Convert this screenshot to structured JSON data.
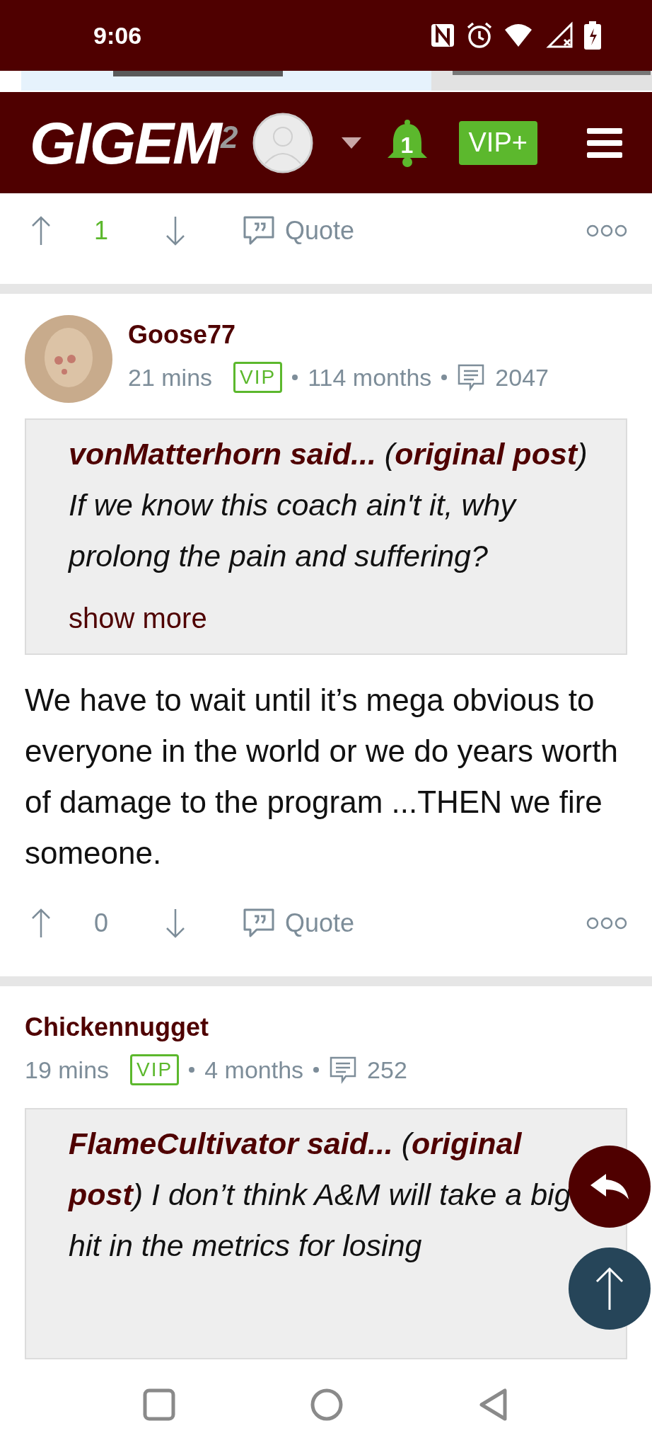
{
  "status_bar": {
    "time": "9:06"
  },
  "header": {
    "logo": "GIGEM",
    "logo_superscript": "2",
    "notification_count": "1",
    "vip_button": "VIP+"
  },
  "top_actions": {
    "score": "1",
    "positive": true,
    "quote": "Quote"
  },
  "posts": [
    {
      "author": "Goose77",
      "has_avatar": true,
      "time": "21 mins",
      "badge": "VIP",
      "tenure": "114 months",
      "post_count": "2047",
      "quote": {
        "text": "**vonMatterhorn said...** (**original post**) If we know this coach ain't it, why prolong the pain and suffering?",
        "show_more": "show more"
      },
      "body": "We have to wait until it’s mega obvious to everyone in the world or we do years worth of damage to the program ...THEN we fire someone.",
      "actions": {
        "score": "0",
        "positive": false,
        "quote": "Quote"
      }
    },
    {
      "author": "Chickennugget",
      "has_avatar": false,
      "time": "19 mins",
      "badge": "VIP",
      "tenure": "4 months",
      "post_count": "252",
      "quote": {
        "text": "**FlameCultivator said...** (**original post**) I don’t think A&M will take a big hit in the metrics for losing"
      }
    }
  ]
}
